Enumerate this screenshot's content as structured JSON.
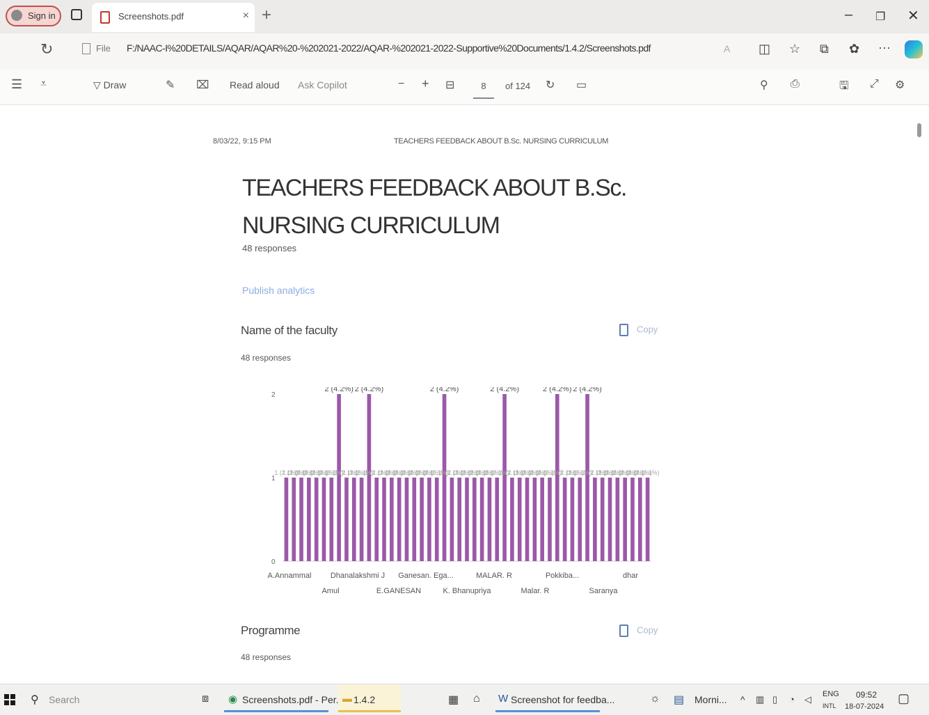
{
  "browser": {
    "signin_label": "Sign in",
    "tab_title": "Screenshots.pdf",
    "tab_close": "×",
    "new_tab": "+",
    "file_label": "File",
    "url": "F:/NAAC-I%20DETAILS/AQAR/AQAR%20-%202021-2022/AQAR-%202021-2022-Supportive%20Documents/1.4.2/Screenshots.pdf"
  },
  "pdf_toolbar": {
    "draw_label": "Draw",
    "read_aloud_label": "Read aloud",
    "ask_copilot_label": "Ask Copilot",
    "zoom_out": "−",
    "zoom_in": "+",
    "page_number": "8",
    "page_total": "of 124"
  },
  "document": {
    "header_datetime": "8/03/22, 9:15 PM",
    "header_title": "TEACHERS FEEDBACK ABOUT B.Sc. NURSING CURRICULUM",
    "form_title": "TEACHERS FEEDBACK ABOUT B.Sc. NURSING CURRICULUM",
    "response_count": "48 responses",
    "publish_link": "Publish analytics",
    "questions": [
      {
        "title": "Name of the faculty",
        "responses": "48 responses",
        "copy_label": "Copy"
      },
      {
        "title": "Programme",
        "responses": "48 responses",
        "copy_label": "Copy"
      }
    ]
  },
  "chart_data": {
    "type": "bar",
    "ylim": [
      0,
      2
    ],
    "y_ticks": [
      "0",
      "1",
      "2"
    ],
    "x_tick_labels_row1": [
      "A.Annammal",
      "Dhanalakshmi J",
      "Ganesan. Ega...",
      "MALAR. R",
      "Pokkiba...",
      "dhar"
    ],
    "x_tick_labels_row2": [
      "Amul",
      "E.GANESAN",
      "K. Bhanupriya",
      "Malar. R",
      "Saranya"
    ],
    "values": [
      1,
      1,
      1,
      1,
      1,
      1,
      1,
      2,
      1,
      1,
      1,
      2,
      1,
      1,
      1,
      1,
      1,
      1,
      1,
      1,
      1,
      2,
      1,
      1,
      1,
      1,
      1,
      1,
      1,
      2,
      1,
      1,
      1,
      1,
      1,
      1,
      2,
      1,
      1,
      1,
      2,
      1,
      1,
      1,
      1,
      1,
      1,
      1,
      1
    ],
    "label_two": "2 (4.2%)",
    "label_one": "1 (2.1%)",
    "color": "#9b59a8"
  },
  "taskbar": {
    "search_label": "Search",
    "apps": [
      "Screenshots.pdf - Per...",
      "1.4.2",
      "Screenshot for feedba..."
    ],
    "tray_app": "Morni...",
    "lang": "ENG",
    "lang2": "INTL",
    "time": "09:52",
    "date": "18-07-2024"
  }
}
